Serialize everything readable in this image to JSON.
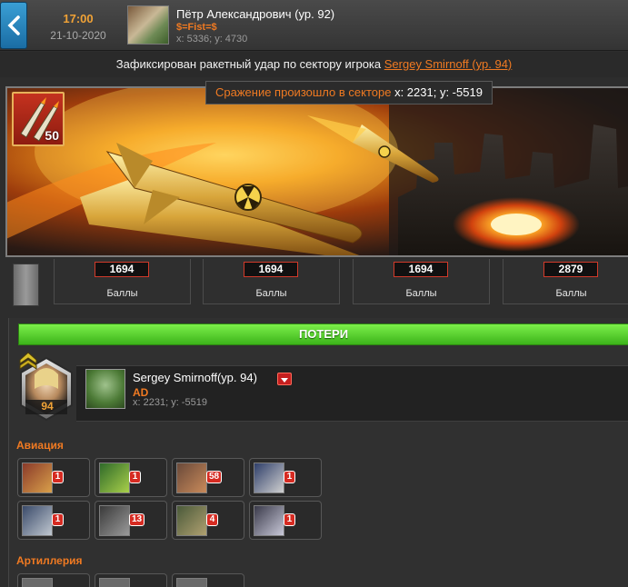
{
  "header": {
    "time": "17:00",
    "date": "21-10-2020",
    "player_name": "Пётр Александрович (ур. 92)",
    "player_clan": "$=Fist=$",
    "player_coords": "x: 5336; y: 4730"
  },
  "notification": {
    "text": "Зафиксирован ракетный удар по сектору игрока",
    "target_link": "Sergey Smirnoff (ур. 94)"
  },
  "banner": {
    "missile_count": "50",
    "tooltip_label": "Сражение произошло в секторе",
    "tooltip_coords": "x: 2231; y: -5519"
  },
  "scores": [
    {
      "value": "1694",
      "label": "Баллы"
    },
    {
      "value": "1694",
      "label": "Баллы"
    },
    {
      "value": "1694",
      "label": "Баллы"
    },
    {
      "value": "2879",
      "label": "Баллы"
    }
  ],
  "losses": {
    "title": "ПОТЕРИ",
    "level": "94",
    "opponent_name": "Sergey Smirnoff(ур. 94)",
    "opponent_clan": "AD",
    "opponent_coords": "x: 2231; y: -5519",
    "sections": [
      {
        "title": "Авиация",
        "units": [
          {
            "qty": "1",
            "color": "#8a3a2a"
          },
          {
            "qty": "1",
            "color": "#2f6a2a"
          },
          {
            "qty": "58",
            "color": "#6a4a3a"
          },
          {
            "qty": "1",
            "color": "#2f3f6a"
          },
          {
            "qty": "1",
            "color": "#3a4a6a"
          },
          {
            "qty": "13",
            "color": "#3a3a3a"
          },
          {
            "qty": "4",
            "color": "#4a5a3a"
          },
          {
            "qty": "1",
            "color": "#3a3a4a"
          }
        ]
      },
      {
        "title": "Артиллерия",
        "units": [
          {
            "qty": "",
            "color": "#5a5a5a"
          },
          {
            "qty": "",
            "color": "#5a5a5a"
          },
          {
            "qty": "",
            "color": "#5a5a5a"
          }
        ]
      }
    ]
  },
  "colors": {
    "accent": "#f07a22",
    "lossbar": "#4cc21e",
    "qty_badge": "#d62b22"
  }
}
